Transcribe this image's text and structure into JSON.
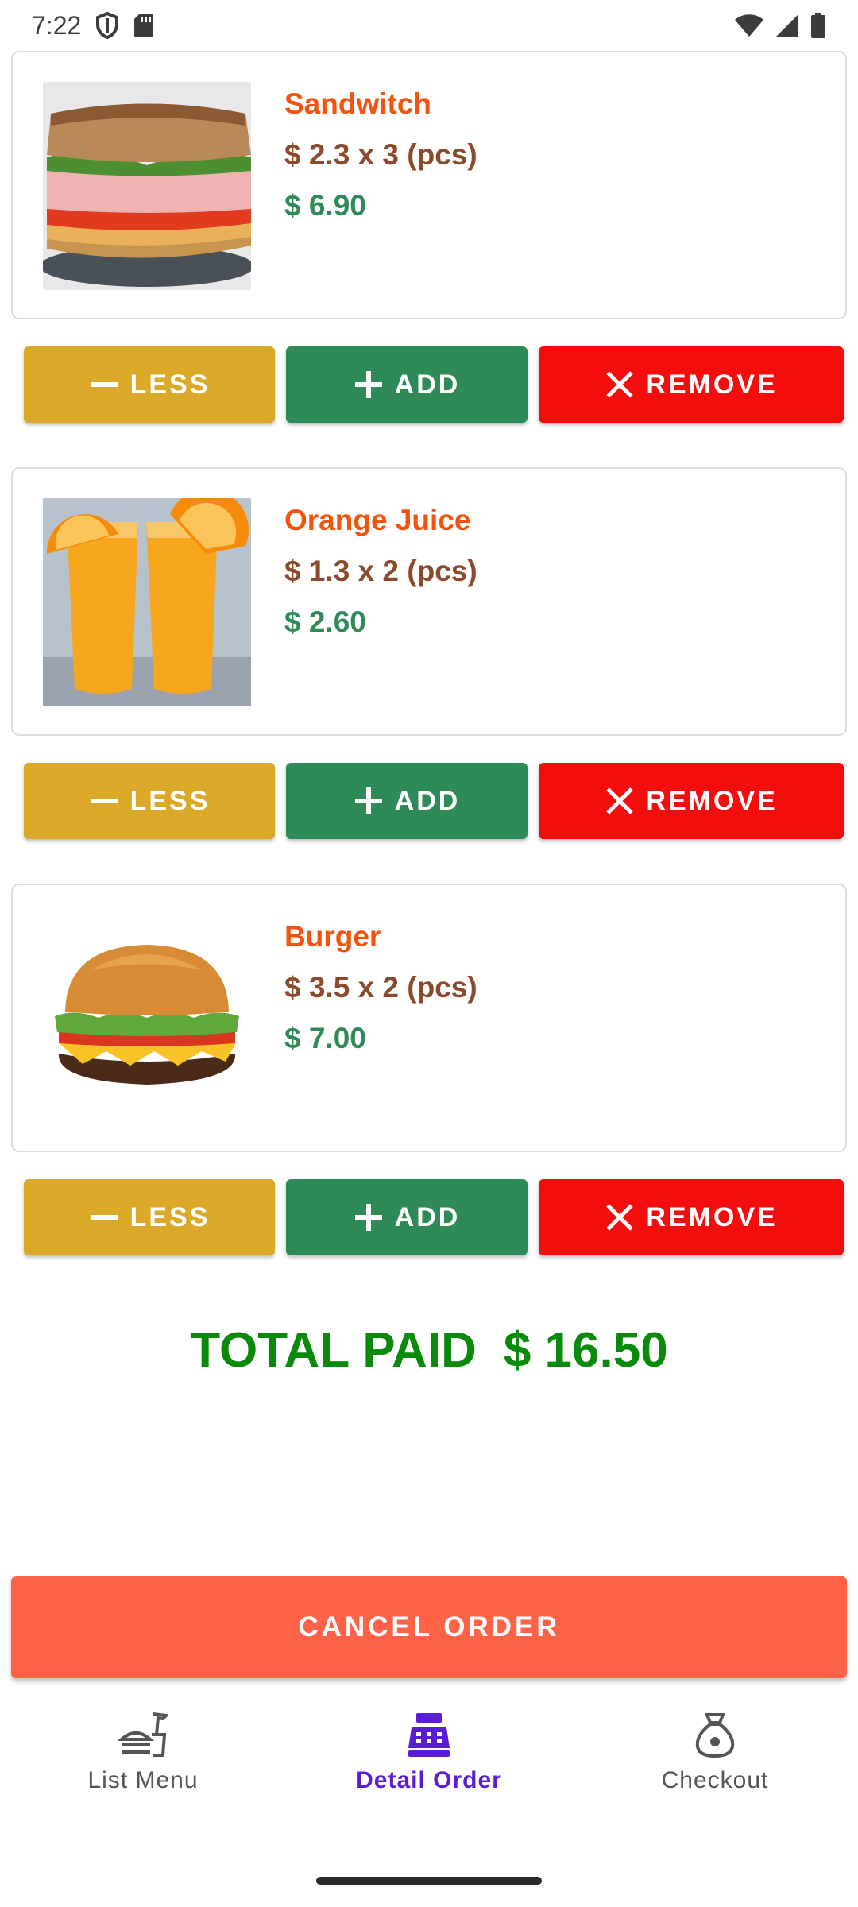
{
  "status_bar": {
    "time": "7:22"
  },
  "order_items": [
    {
      "name": "Sandwitch",
      "price_line": "$ 2.3 x 3 (pcs)",
      "total": "$ 6.90"
    },
    {
      "name": "Orange Juice",
      "price_line": "$ 1.3 x 2 (pcs)",
      "total": "$ 2.60"
    },
    {
      "name": "Burger",
      "price_line": "$ 3.5 x 2 (pcs)",
      "total": "$ 7.00"
    }
  ],
  "buttons": {
    "less": "LESS",
    "add": "ADD",
    "remove": "REMOVE"
  },
  "total": {
    "label": "TOTAL PAID",
    "amount": "$ 16.50"
  },
  "cancel_label": "CANCEL ORDER",
  "nav": {
    "items": [
      {
        "label": "List Menu",
        "icon": "fast-food-icon"
      },
      {
        "label": "Detail Order",
        "icon": "cash-register-icon",
        "active": true
      },
      {
        "label": "Checkout",
        "icon": "money-bag-icon"
      }
    ]
  },
  "colors": {
    "name": "#f2540f",
    "price": "#8b4a2b",
    "subtotal": "#2e8b57",
    "less": "#d9a927",
    "add": "#2e8b57",
    "remove": "#f30d0d",
    "total": "#0a8a0a",
    "cancel": "#ff6347",
    "nav_active": "#5b1cd6"
  }
}
